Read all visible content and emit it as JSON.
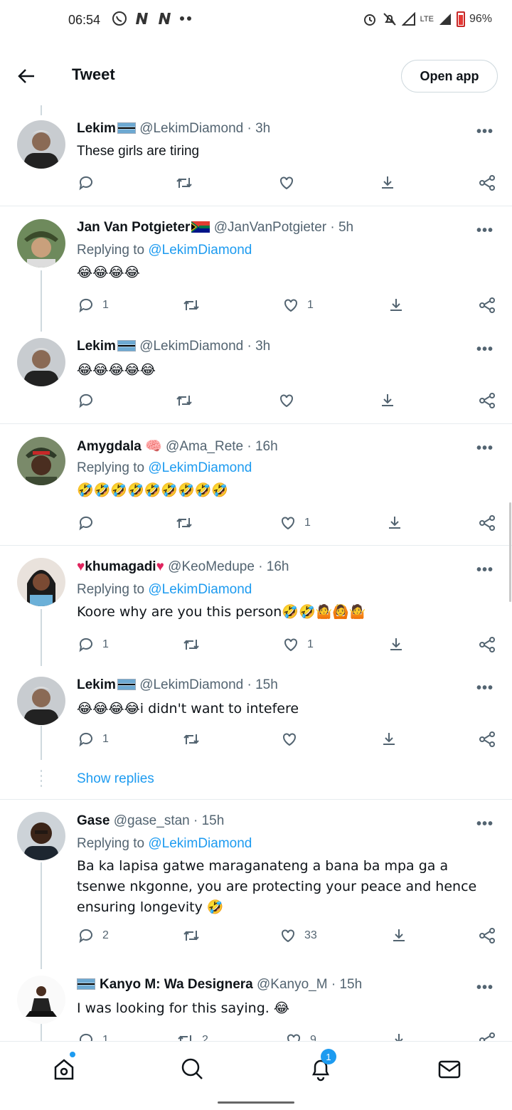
{
  "status_bar": {
    "time": "06:54",
    "network": "LTE",
    "battery": "96%"
  },
  "header": {
    "title": "Tweet",
    "open_app": "Open app"
  },
  "replying_prefix": "Replying to ",
  "tweets": [
    {
      "name": "Lekim",
      "handle": "@LekimDiamond · 3h",
      "reply_to": "",
      "text": "These girls are tiring",
      "replies": "",
      "retweets": "",
      "likes": ""
    },
    {
      "name": "Jan Van Potgieter",
      "handle": "@JanVanPotgieter · 5h",
      "reply_to": "@LekimDiamond",
      "text": "😂😂😂😂",
      "replies": "1",
      "retweets": "",
      "likes": "1"
    },
    {
      "name": "Lekim",
      "handle": "@LekimDiamond · 3h",
      "reply_to": "",
      "text": "😂😂😂😂😂",
      "replies": "",
      "retweets": "",
      "likes": ""
    },
    {
      "name": "Amygdala",
      "handle": "@Ama_Rete · 16h",
      "reply_to": "@LekimDiamond",
      "text": "🤣🤣🤣🤣🤣🤣🤣🤣🤣",
      "replies": "",
      "retweets": "",
      "likes": "1"
    },
    {
      "name": "khumagadi",
      "handle": "@KeoMedupe · 16h",
      "reply_to": "@LekimDiamond",
      "text": "Koore why are you this person🤣🤣🤷🙆🤷",
      "replies": "1",
      "retweets": "",
      "likes": "1"
    },
    {
      "name": "Lekim",
      "handle": "@LekimDiamond · 15h",
      "reply_to": "",
      "text": "😂😂😂😂i didn't want to intefere",
      "replies": "1",
      "retweets": "",
      "likes": ""
    },
    {
      "name": "Gase",
      "handle": "@gase_stan · 15h",
      "reply_to": "@LekimDiamond",
      "text": "Ba ka lapisa gatwe maraganateng a bana ba mpa ga a tsenwe nkgonne, you are protecting your peace and hence ensuring longevity 🤣",
      "replies": "2",
      "retweets": "",
      "likes": "33"
    },
    {
      "name": "Kanyo M: Wa Designera",
      "handle": "@Kanyo_M · 15h",
      "reply_to": "",
      "text": "I was looking for this saying. 😂",
      "replies": "1",
      "retweets": "2",
      "likes": "9"
    }
  ],
  "show_replies": "Show replies",
  "more_label": "•••",
  "nav": {
    "notifications_badge": "1"
  }
}
